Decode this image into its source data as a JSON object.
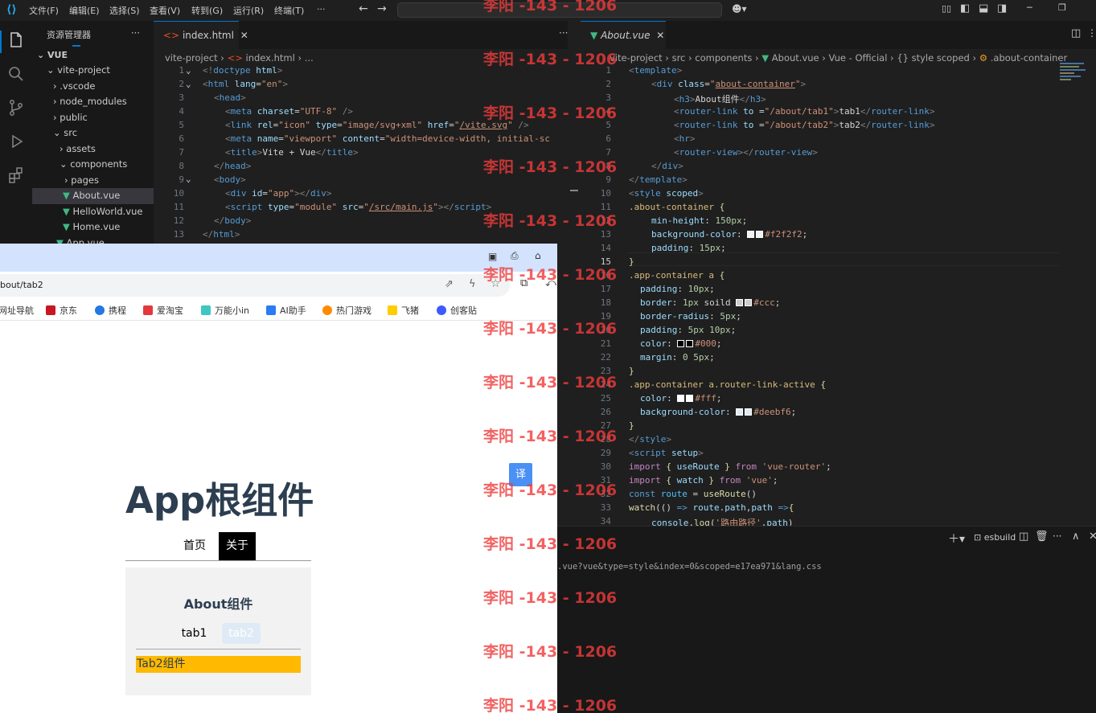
{
  "titlebar": {
    "menus": [
      "文件(F)",
      "编辑(E)",
      "选择(S)",
      "查看(V)",
      "转到(G)",
      "运行(R)",
      "终端(T)",
      "···"
    ]
  },
  "explorer": {
    "header": "资源管理器",
    "root": "VUE",
    "items": [
      "vite-project",
      ".vscode",
      "node_modules",
      "public",
      "src",
      "assets",
      "components",
      "pages",
      "About.vue",
      "HelloWorld.vue",
      "Home.vue",
      "App.vue"
    ]
  },
  "html_editor": {
    "tab": "index.html",
    "breadcrumb": [
      "vite-project",
      "index.html",
      "..."
    ],
    "line_numbers": [
      "1",
      "2",
      "3",
      "4",
      "5",
      "6",
      "7",
      "8",
      "9",
      "10",
      "11",
      "12",
      "13"
    ]
  },
  "vue_editor": {
    "tab": "About.vue",
    "breadcrumb": [
      "vite-project",
      "src",
      "components",
      "About.vue",
      "Vue - Official",
      "{} style scoped",
      ".about-container"
    ],
    "line_numbers": [
      "1",
      "2",
      "3",
      "4",
      "5",
      "6",
      "7",
      "8",
      "9",
      "10",
      "11",
      "12",
      "13",
      "14",
      "15",
      "16",
      "17",
      "18",
      "19",
      "20",
      "21",
      "22",
      "23",
      "24",
      "25",
      "26",
      "27",
      "28",
      "29",
      "30",
      "31",
      "32",
      "33",
      "34"
    ]
  },
  "panel": {
    "profile": "esbuild",
    "output": ".vue?vue&type=style&index=0&scoped=e17ea971&lang.css"
  },
  "browser": {
    "address": "bout/tab2",
    "bookmarks": [
      "网址导航",
      "京东",
      "携程",
      "爱淘宝",
      "万能小in",
      "AI助手",
      "热门游戏",
      "飞猪",
      "创客贴"
    ],
    "translate_badge": "译",
    "app": {
      "title": "App根组件",
      "nav": [
        "首页",
        "关于"
      ],
      "about_title": "About组件",
      "tabs": [
        "tab1",
        "tab2"
      ],
      "tab_content": "Tab2组件"
    }
  },
  "watermark": "李阳 -143 - 1206",
  "colors": {
    "swatch_f2": "#f2f2f2",
    "swatch_ccc": "#ccc",
    "swatch_000": "#000",
    "swatch_fff": "#fff",
    "swatch_deebf6": "#deebf6",
    "tab_content_bg": "#ffb900"
  }
}
